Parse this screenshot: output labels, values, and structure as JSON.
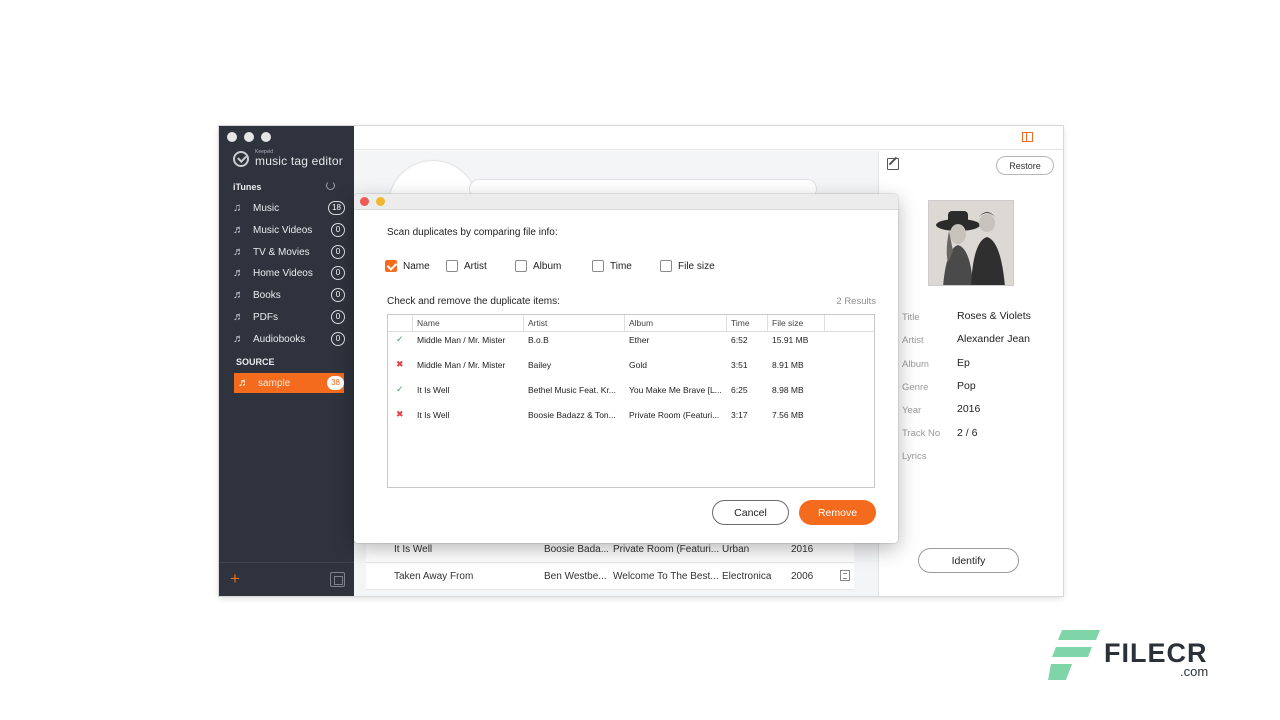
{
  "sidebar": {
    "logo_brand": "Keepvid",
    "logo_name": "music tag editor",
    "itunes_heading": "iTunes",
    "items": [
      {
        "label": "Music",
        "count": "18",
        "icon": "music-note-icon"
      },
      {
        "label": "Music Videos",
        "count": "0",
        "icon": "playlist-icon"
      },
      {
        "label": "TV & Movies",
        "count": "0",
        "icon": "playlist-icon"
      },
      {
        "label": "Home Videos",
        "count": "0",
        "icon": "playlist-icon"
      },
      {
        "label": "Books",
        "count": "0",
        "icon": "playlist-icon"
      },
      {
        "label": "PDFs",
        "count": "0",
        "icon": "playlist-icon"
      },
      {
        "label": "Audiobooks",
        "count": "0",
        "icon": "playlist-icon"
      }
    ],
    "source_heading": "SOURCE",
    "source_item": {
      "label": "sample",
      "count": "38",
      "icon": "playlist-icon"
    },
    "add_label": "+"
  },
  "background_rows": [
    {
      "name": "It Is Well",
      "artist": "Boosie Bada...",
      "album": "Private Room (Featuri...",
      "genre": "Urban",
      "year": "2016"
    },
    {
      "name": "Taken Away From",
      "artist": "Ben Westbe...",
      "album": "Welcome To The Best...",
      "genre": "Electronica",
      "year": "2006"
    }
  ],
  "right_panel": {
    "restore_label": "Restore",
    "identify_label": "Identify",
    "tags": [
      {
        "label": "Title",
        "value": "Roses & Violets"
      },
      {
        "label": "Artist",
        "value": "Alexander Jean"
      },
      {
        "label": "Album",
        "value": "Ep"
      },
      {
        "label": "Genre",
        "value": "Pop"
      },
      {
        "label": "Year",
        "value": "2016"
      },
      {
        "label": "Track No",
        "value": "2 / 6"
      },
      {
        "label": "Lyrics",
        "value": ""
      }
    ]
  },
  "dialog": {
    "scan_prompt": "Scan duplicates by comparing file info:",
    "options": [
      {
        "label": "Name",
        "checked": true
      },
      {
        "label": "Artist",
        "checked": false
      },
      {
        "label": "Album",
        "checked": false
      },
      {
        "label": "Time",
        "checked": false
      },
      {
        "label": "File size",
        "checked": false
      }
    ],
    "check_prompt": "Check and remove the duplicate items:",
    "results": "2 Results",
    "columns": [
      "Name",
      "Artist",
      "Album",
      "Time",
      "File size"
    ],
    "rows": [
      {
        "keep": true,
        "name": "Middle Man / Mr. Mister",
        "artist": "B.o.B",
        "album": "Ether",
        "time": "6:52",
        "size": "15.91 MB"
      },
      {
        "keep": false,
        "name": "Middle Man / Mr. Mister",
        "artist": "Bailey",
        "album": "Gold",
        "time": "3:51",
        "size": "8.91 MB"
      },
      {
        "keep": true,
        "name": "It Is Well",
        "artist": "Bethel Music Feat. Kr...",
        "album": "You Make Me Brave [L...",
        "time": "6:25",
        "size": "8.98 MB"
      },
      {
        "keep": false,
        "name": "It Is Well",
        "artist": "Boosie Badazz & Ton...",
        "album": "Private Room (Featuri...",
        "time": "3:17",
        "size": "7.56 MB"
      }
    ],
    "cancel_label": "Cancel",
    "remove_label": "Remove"
  },
  "watermark": {
    "text": "FILECR",
    "suffix": ".com"
  },
  "colors": {
    "accent": "#f56b1d",
    "sidebar": "#2e333d",
    "ok": "#3aa35a",
    "remove": "#e04040"
  }
}
